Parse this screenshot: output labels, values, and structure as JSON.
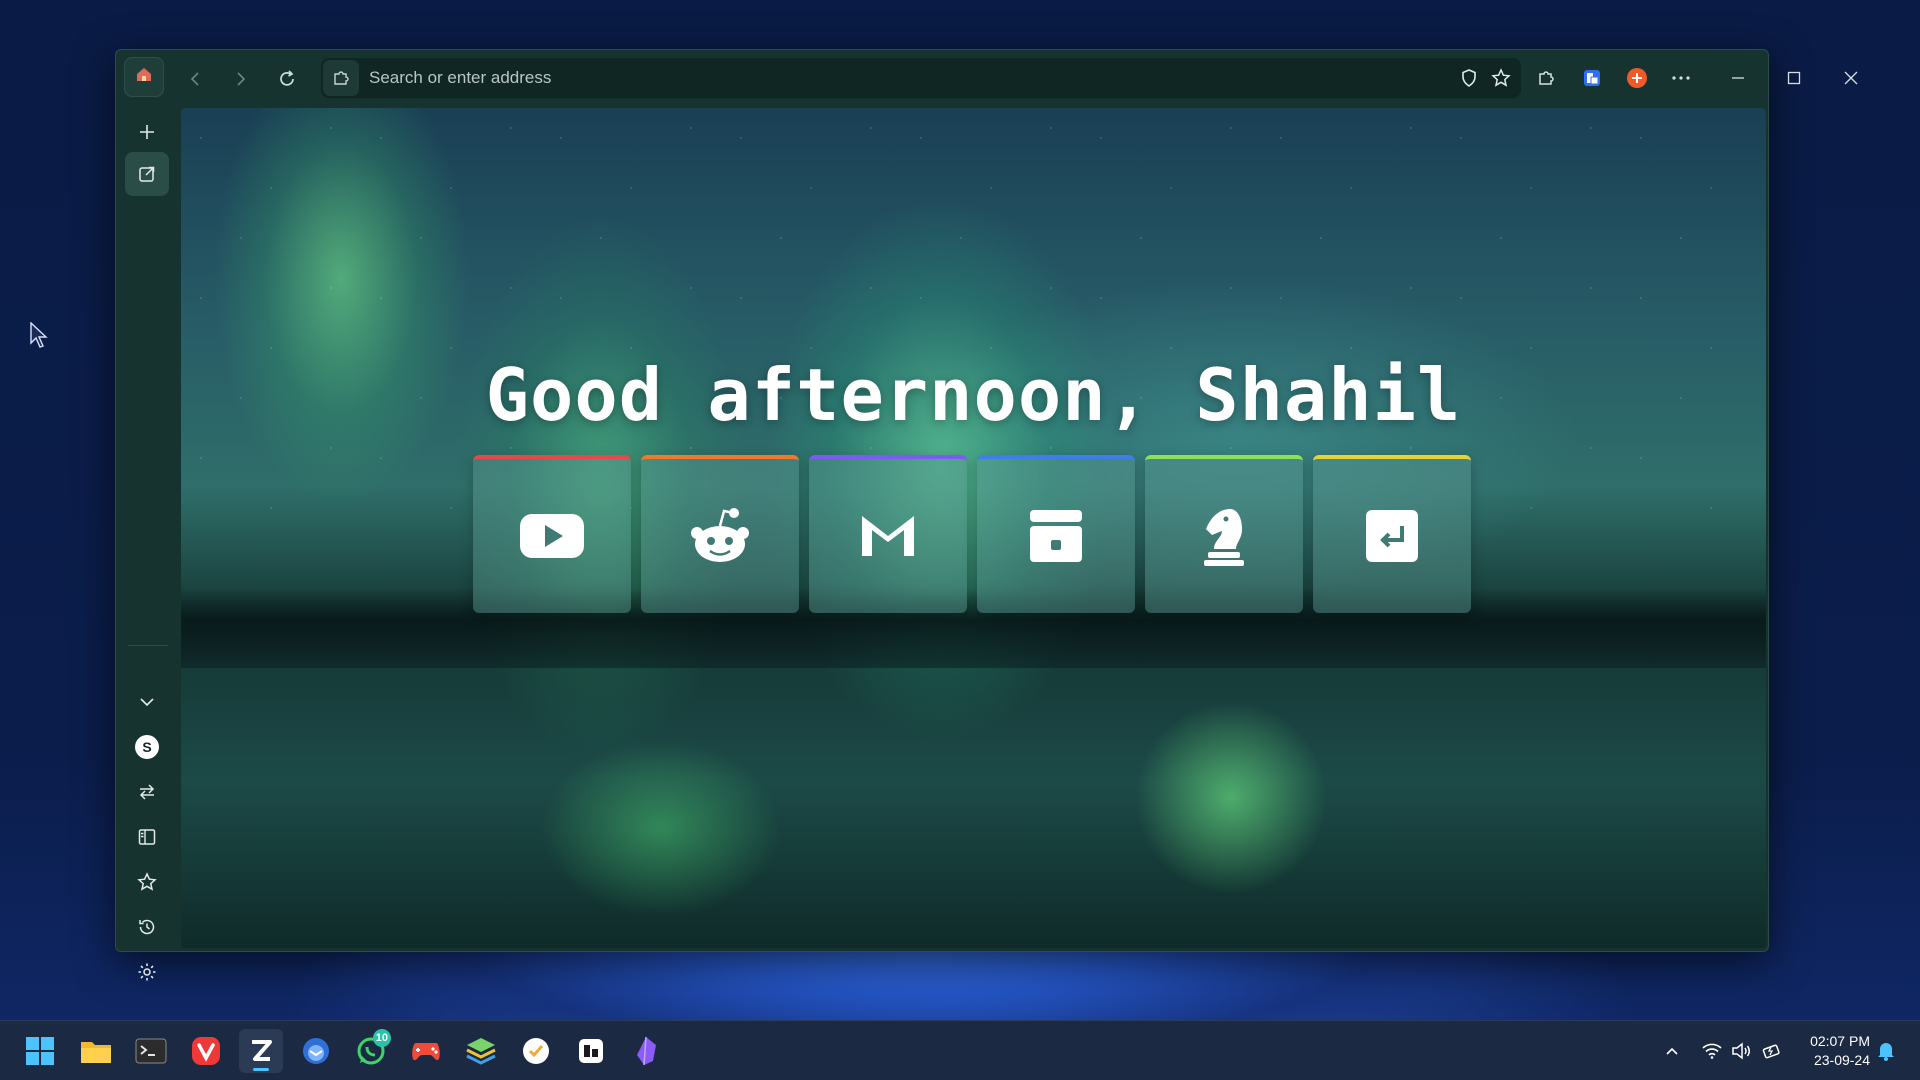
{
  "browser": {
    "address_placeholder": "Search or enter address"
  },
  "newtab": {
    "greeting": "Good afternoon, Shahil",
    "shortcuts": [
      {
        "name": "youtube",
        "accent": "#e5484d"
      },
      {
        "name": "reddit",
        "accent": "#f0782f"
      },
      {
        "name": "mail",
        "accent": "#7c5cf0"
      },
      {
        "name": "archive",
        "accent": "#3f7ee8"
      },
      {
        "name": "chess",
        "accent": "#8ce05a"
      },
      {
        "name": "shortcut",
        "accent": "#e8d23a"
      }
    ]
  },
  "sidebar": {
    "avatar_letter": "S"
  },
  "taskbar": {
    "whatsapp_badge": "10",
    "time": "02:07 PM",
    "date": "23-09-24"
  }
}
